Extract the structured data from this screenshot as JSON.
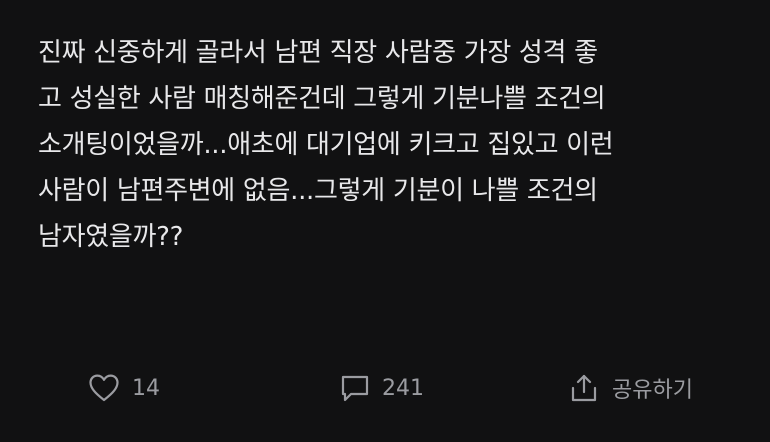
{
  "post": {
    "lines": [
      "진짜 신중하게 골라서 남편 직장 사람중 가장 성격 좋",
      "고 성실한 사람 매칭해준건데 그렇게 기분나쁠 조건의",
      "소개팅이었을까...애초에 대기업에 키크고 집있고 이런",
      "사람이 남편주변에 없음...그렇게 기분이 나쁠 조건의",
      "남자였을까??"
    ]
  },
  "actions": {
    "like": {
      "icon": "heart-icon",
      "count": "14"
    },
    "comment": {
      "icon": "comment-icon",
      "count": "241"
    },
    "share": {
      "icon": "share-icon",
      "label": "공유하기"
    }
  },
  "colors": {
    "background": "#111112",
    "text": "#e8e8ea",
    "muted": "#9b9ca1"
  }
}
